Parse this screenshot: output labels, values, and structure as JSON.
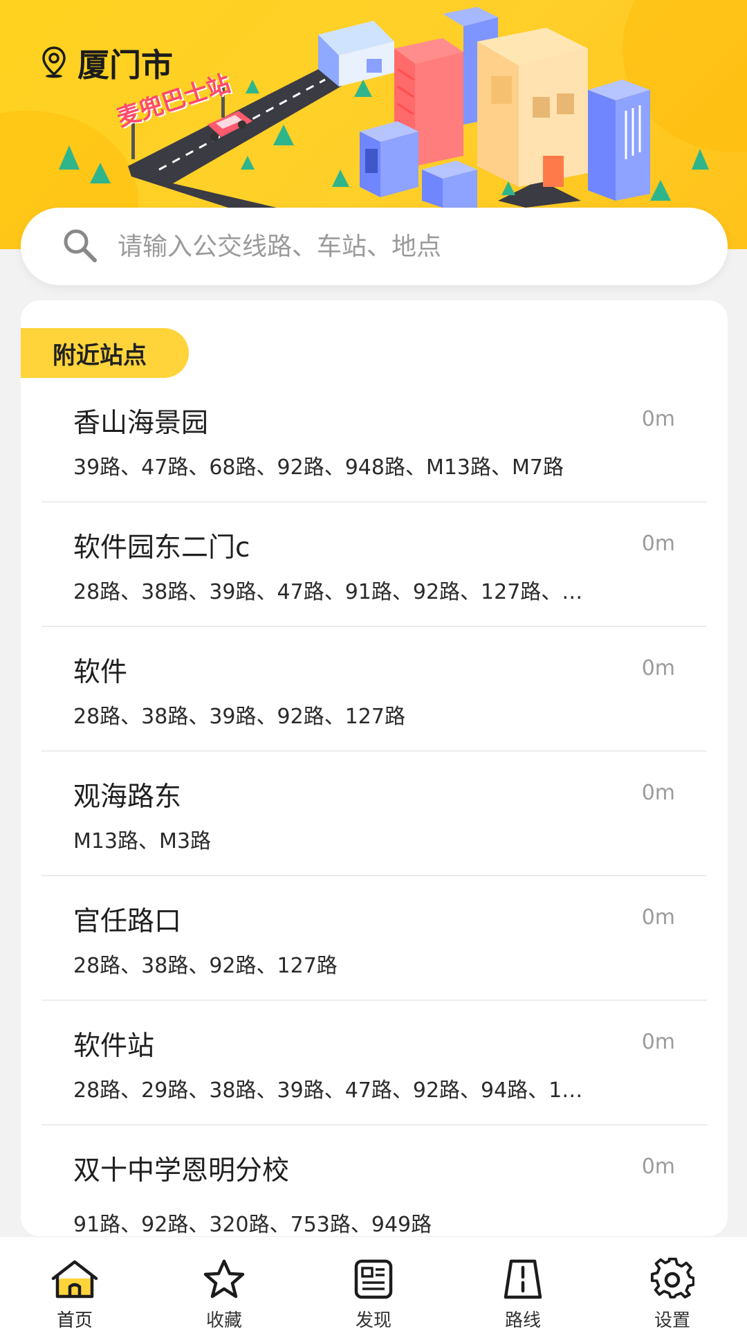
{
  "header": {
    "city": "厦门市",
    "banner_sign": "麦兜巴士站"
  },
  "search": {
    "placeholder": "请输入公交线路、车站、地点"
  },
  "nearby": {
    "title": "附近站点",
    "stations": [
      {
        "name": "香山海景园",
        "distance": "0m",
        "routes": "39路、47路、68路、92路、948路、M13路、M7路"
      },
      {
        "name": "软件园东二门c",
        "distance": "0m",
        "routes": "28路、38路、39路、47路、91路、92路、127路、…"
      },
      {
        "name": "软件",
        "distance": "0m",
        "routes": "28路、38路、39路、92路、127路"
      },
      {
        "name": "观海路东",
        "distance": "0m",
        "routes": "M13路、M3路"
      },
      {
        "name": "官任路口",
        "distance": "0m",
        "routes": "28路、38路、92路、127路"
      },
      {
        "name": "软件站",
        "distance": "0m",
        "routes": "28路、29路、38路、39路、47路、92路、94路、1…"
      },
      {
        "name": "双十中学恩明分校",
        "distance": "0m",
        "routes": "91路、92路、320路、753路、949路"
      }
    ]
  },
  "tabbar": {
    "tabs": [
      {
        "label": "首页",
        "icon": "home-icon"
      },
      {
        "label": "收藏",
        "icon": "star-icon"
      },
      {
        "label": "发现",
        "icon": "news-icon"
      },
      {
        "label": "路线",
        "icon": "road-icon"
      },
      {
        "label": "设置",
        "icon": "gear-icon"
      }
    ]
  },
  "colors": {
    "accent": "#ffd43b",
    "banner": "#ffd21f"
  }
}
